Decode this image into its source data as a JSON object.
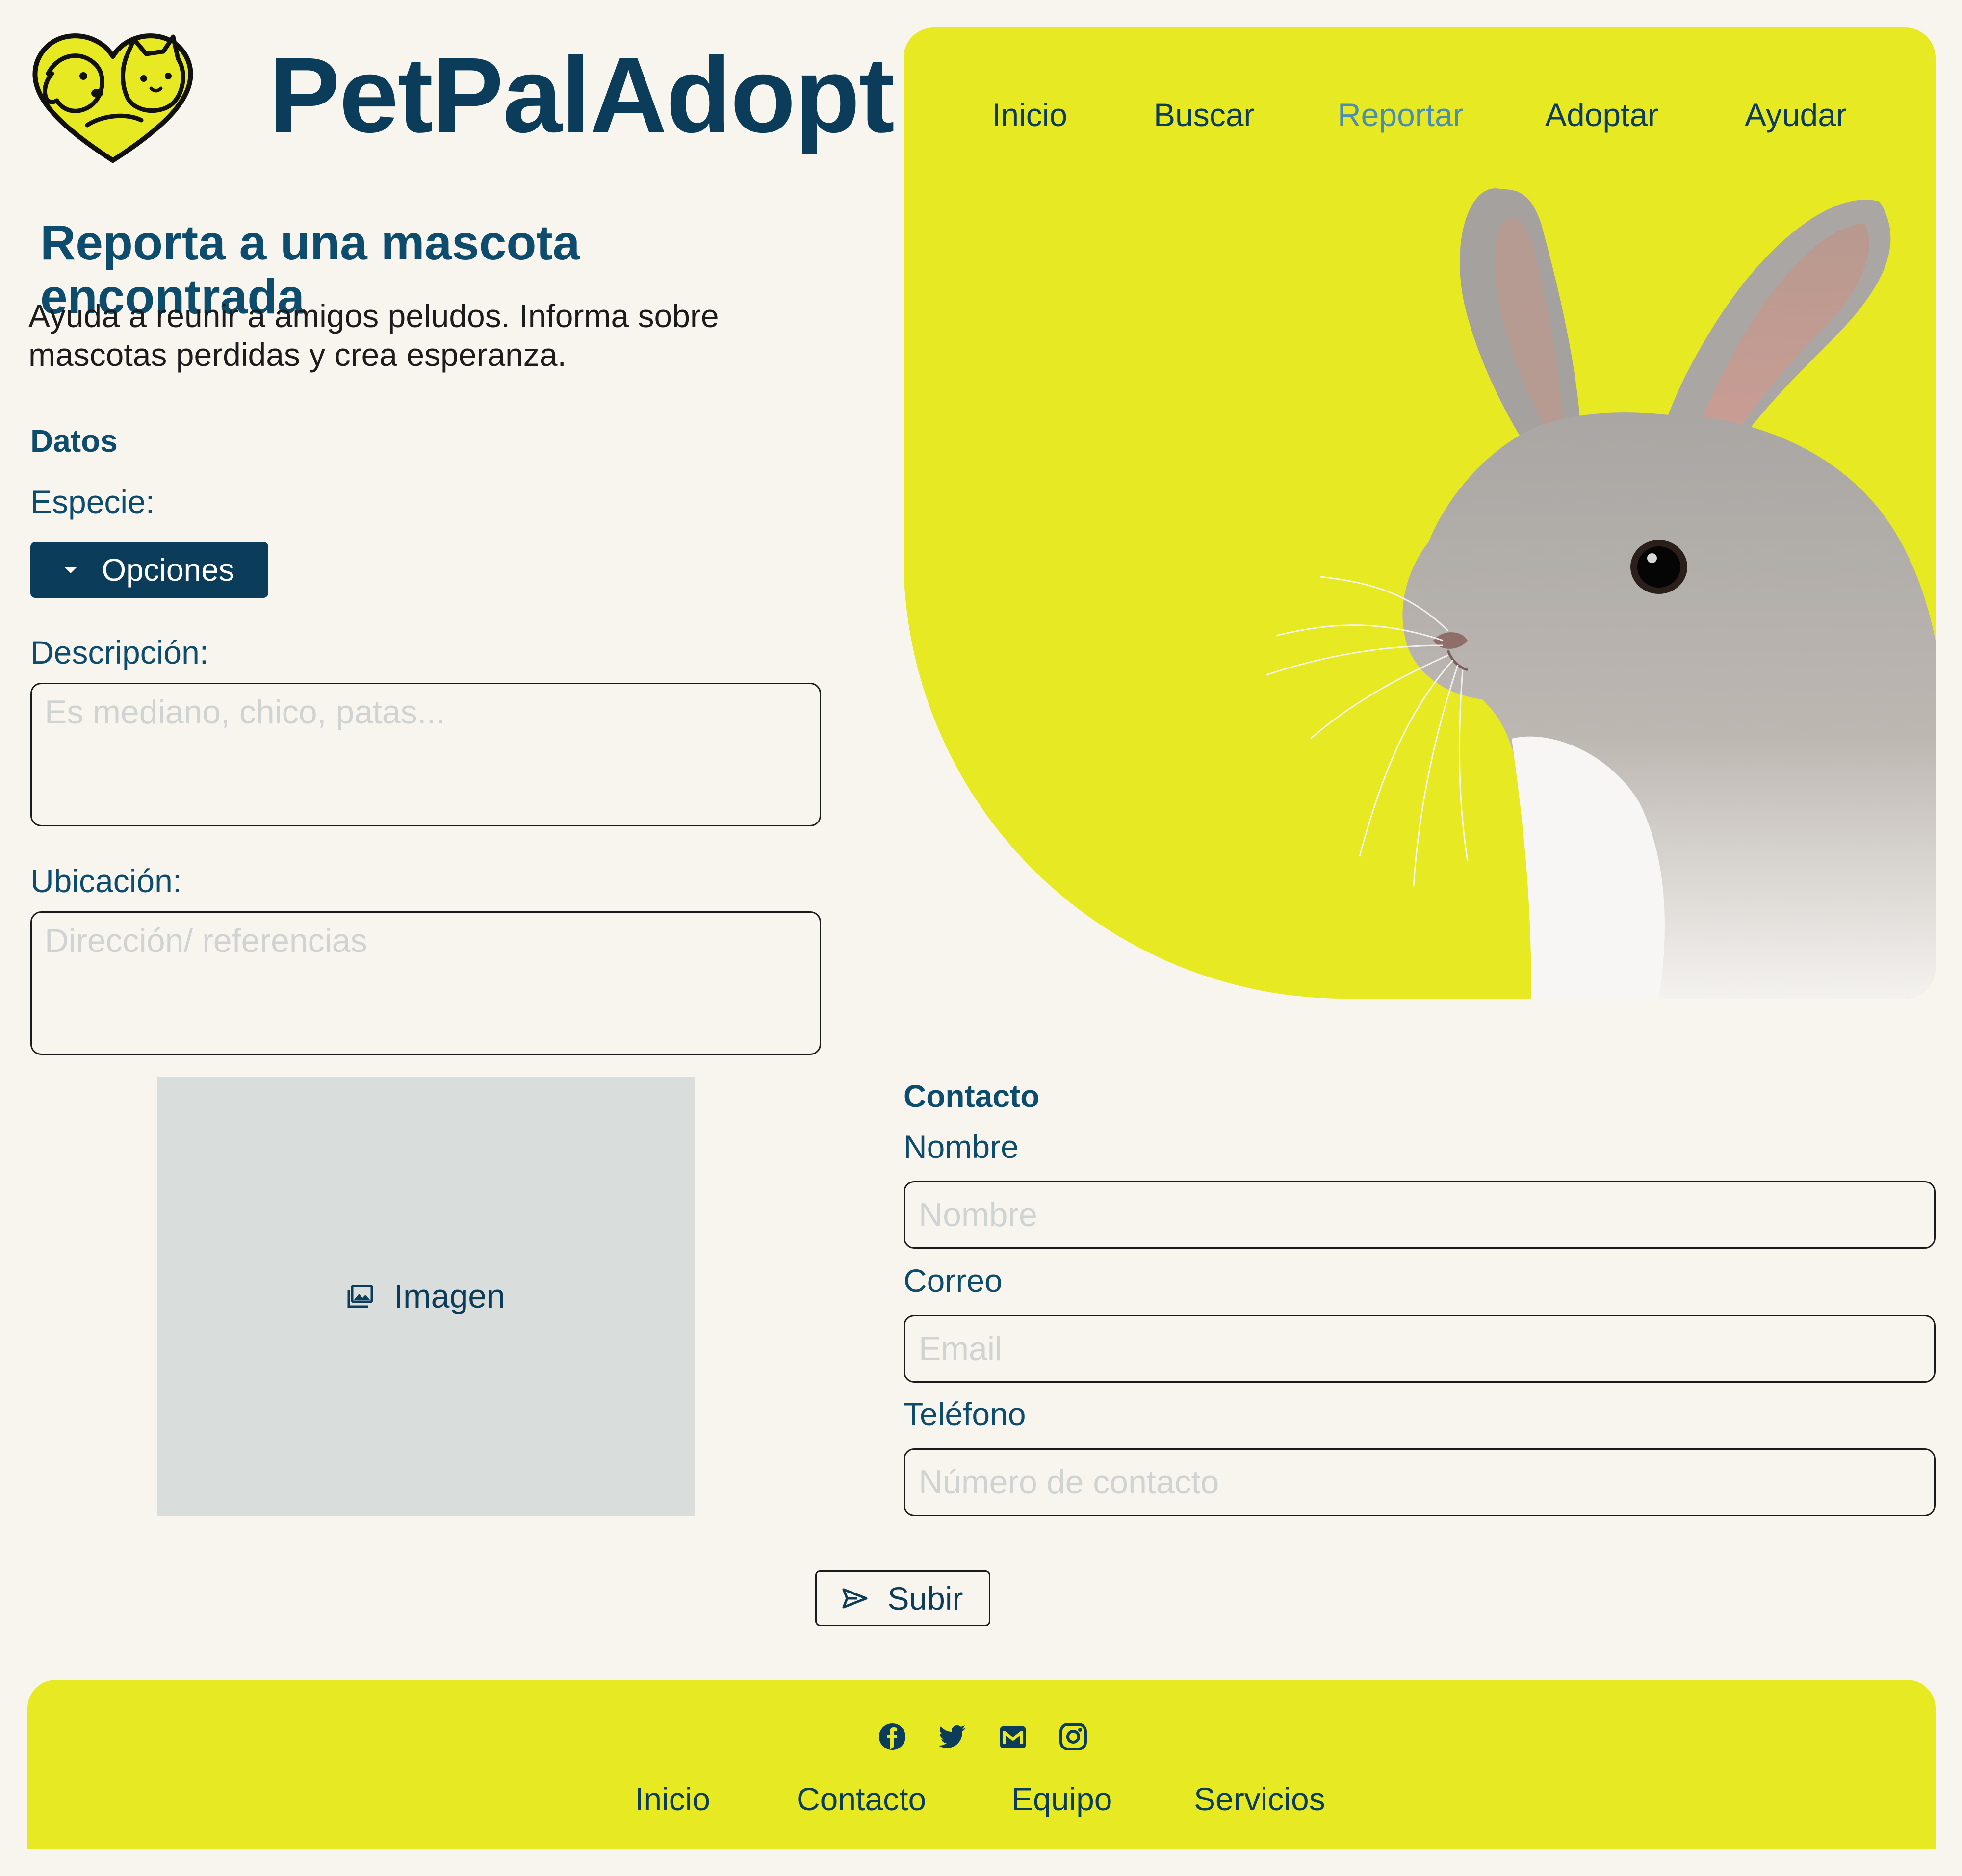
{
  "brand": {
    "name": "PetPalAdopt",
    "logo_icon": "dog-cat-heart-icon"
  },
  "nav": {
    "items": [
      {
        "label": "Inicio",
        "active": false
      },
      {
        "label": "Buscar",
        "active": false
      },
      {
        "label": "Reportar",
        "active": true
      },
      {
        "label": "Adoptar",
        "active": false
      },
      {
        "label": "Ayudar",
        "active": false
      }
    ]
  },
  "report": {
    "title": "Reporta a una mascota encontrada",
    "intro": "Ayuda a reunir a amigos peludos. Informa sobre mascotas perdidas y crea esperanza.",
    "datos_heading": "Datos",
    "species_label": "Especie:",
    "species_button": "Opciones",
    "description_label": "Descripción:",
    "description_placeholder": "Es mediano, chico, patas...",
    "location_label": "Ubicación:",
    "location_placeholder": "Dirección/ referencias",
    "image_label": "Imagen"
  },
  "contact": {
    "heading": "Contacto",
    "name_label": "Nombre",
    "name_placeholder": "Nombre",
    "email_label": "Correo",
    "email_placeholder": "Email",
    "phone_label": "Teléfono",
    "phone_placeholder": "Número de contacto"
  },
  "submit_label": "Subir",
  "footer": {
    "social_icons": [
      "facebook-icon",
      "twitter-icon",
      "gmail-icon",
      "instagram-icon"
    ],
    "links": [
      "Inicio",
      "Contacto",
      "Equipo",
      "Servicios"
    ]
  },
  "colors": {
    "primary": "#0b3d5b",
    "accent_yellow": "#e7e922",
    "active_nav": "#4a8fb2",
    "background": "#f8f5ef",
    "image_placeholder": "#d9dddc"
  }
}
